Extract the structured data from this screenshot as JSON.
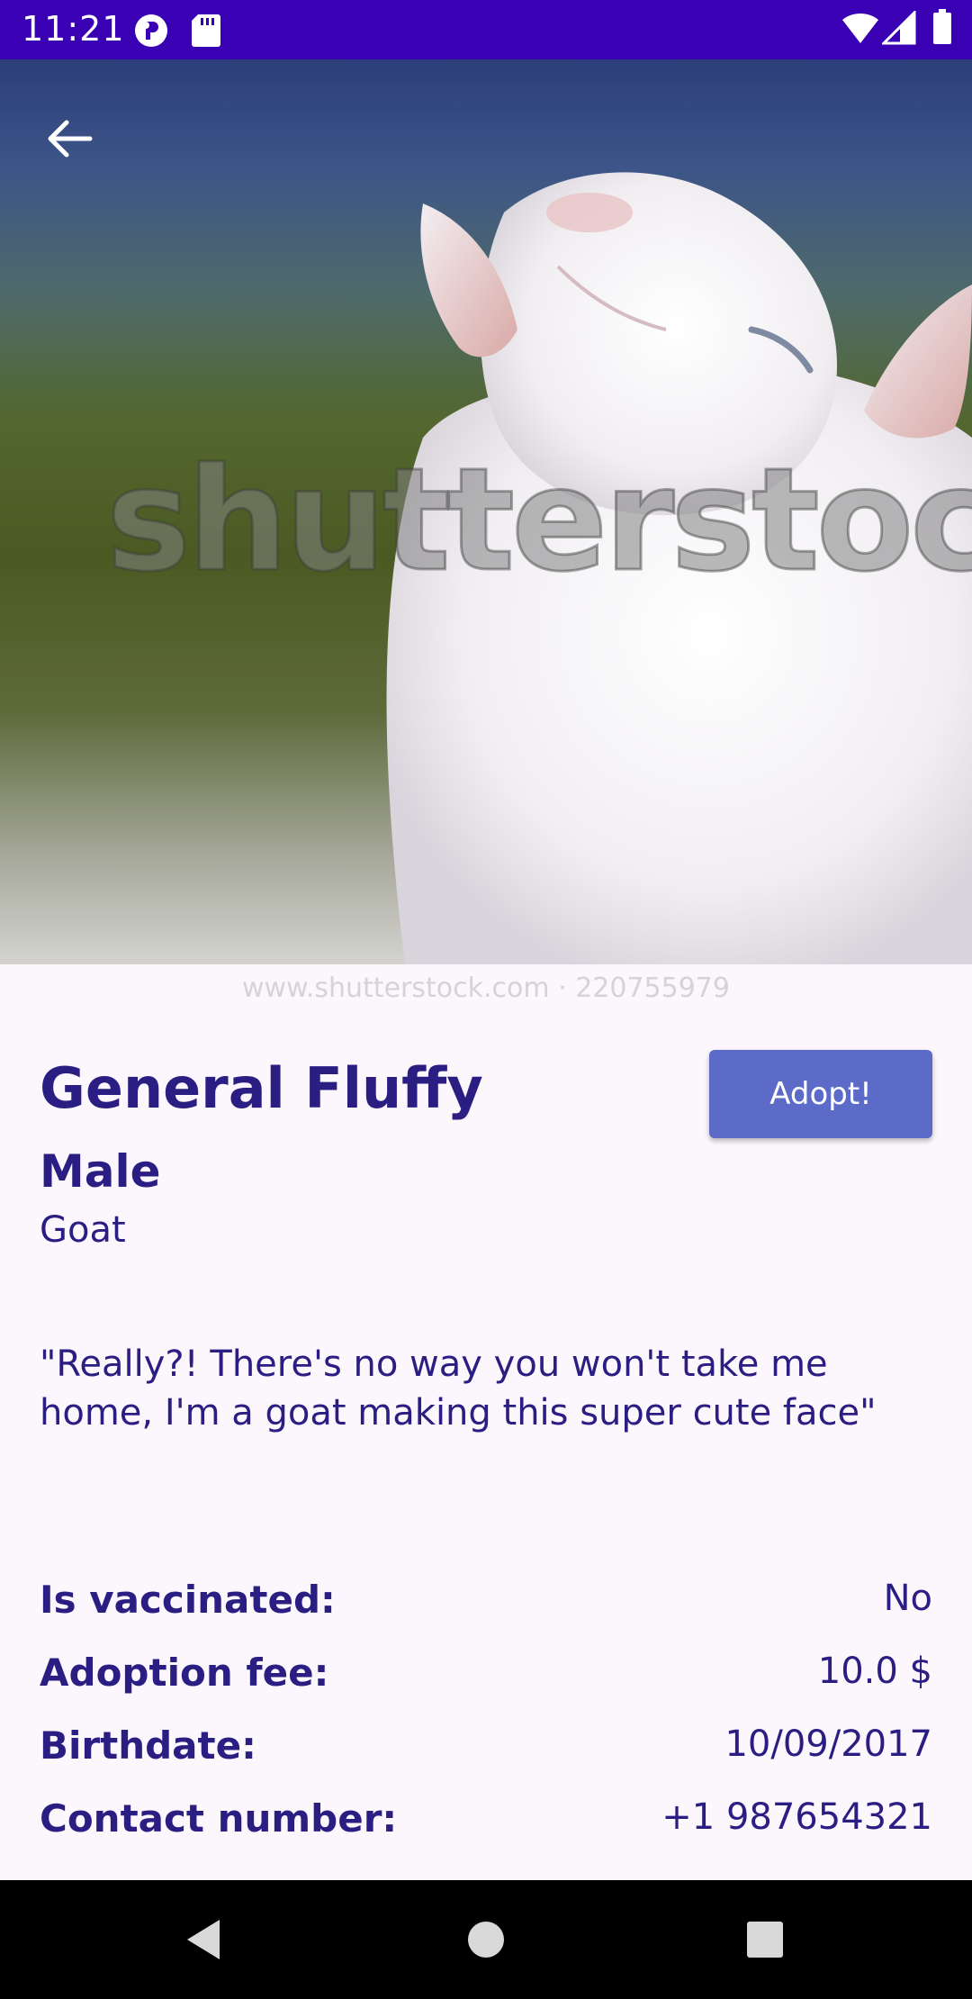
{
  "status_bar": {
    "time": "11:21",
    "icons": [
      "notification-p-icon",
      "sd-card-icon",
      "wifi-icon",
      "cell-signal-icon",
      "battery-icon"
    ]
  },
  "hero": {
    "watermark_text": "shutterstock",
    "watermark_url": "www.shutterstock.com · 220755979"
  },
  "toolbar": {
    "back_icon": "arrow-left-icon"
  },
  "pet": {
    "name": "General Fluffy",
    "gender": "Male",
    "species": "Goat",
    "description": "\"Really?! There's no way you won't take me home, I'm a goat making this super cute face\""
  },
  "adopt_button": {
    "label": "Adopt!"
  },
  "info": [
    {
      "label": "Is vaccinated:",
      "value": "No"
    },
    {
      "label": "Adoption fee:",
      "value": "10.0 $"
    },
    {
      "label": "Birthdate:",
      "value": "10/09/2017"
    },
    {
      "label": "Contact number:",
      "value": "+1 987654321"
    }
  ],
  "nav_bar": {
    "icons": [
      "back-triangle-icon",
      "home-circle-icon",
      "recents-square-icon"
    ]
  },
  "colors": {
    "status_bar": "#3a00b4",
    "primary_text": "#2b1e83",
    "button": "#5c6bc8",
    "background": "#fcf6fd"
  }
}
